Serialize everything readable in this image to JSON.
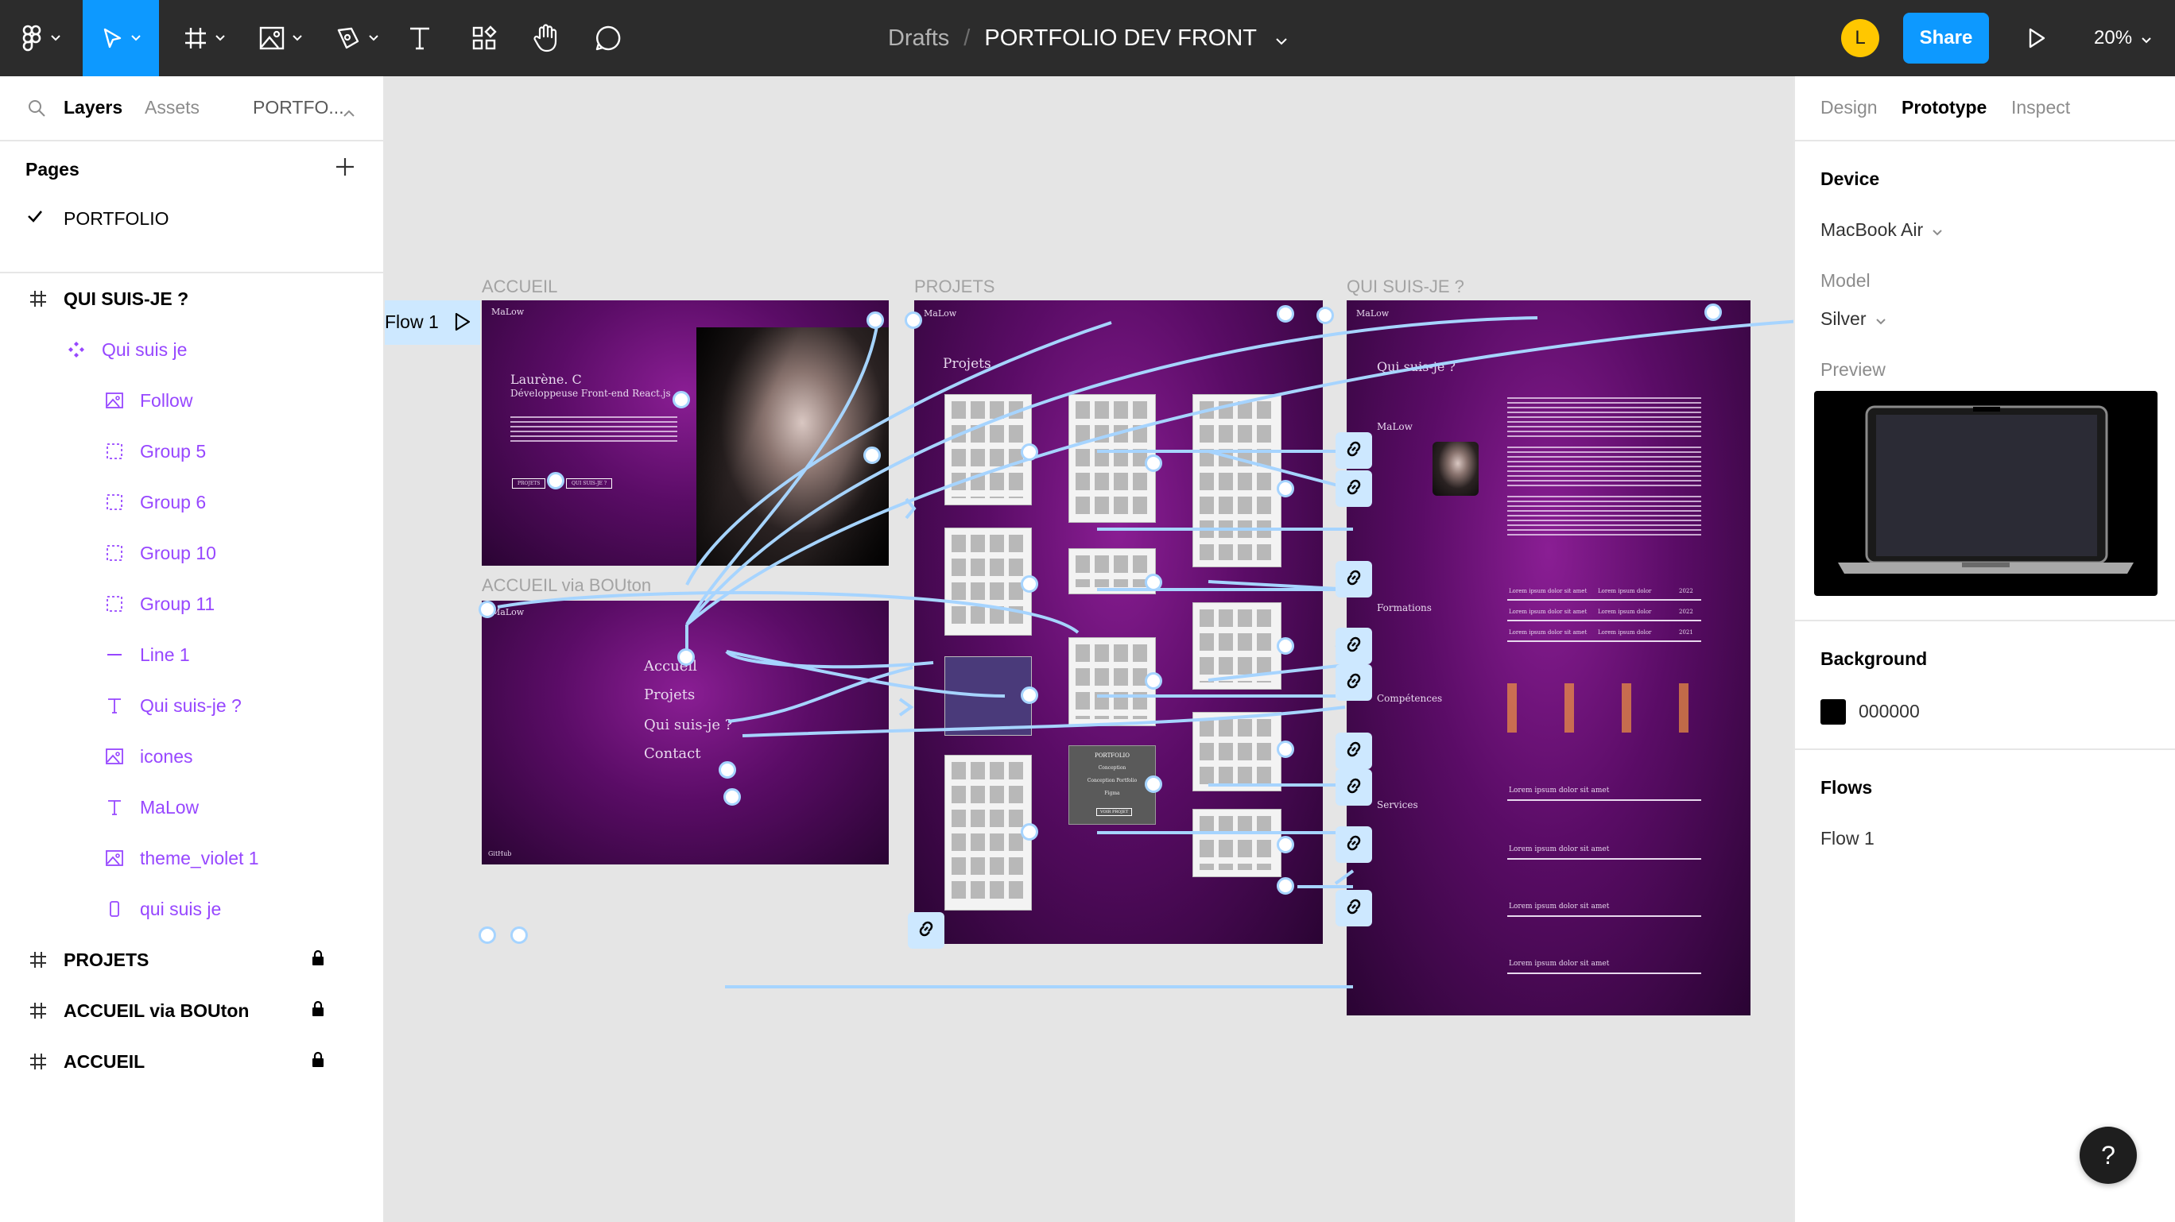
{
  "toolbar": {
    "tools": [
      {
        "name": "main-menu",
        "icon": "figma-logo-icon"
      },
      {
        "name": "move",
        "icon": "move-cursor-icon",
        "active": true
      },
      {
        "name": "frame",
        "icon": "frame-icon"
      },
      {
        "name": "shape",
        "icon": "image-icon"
      },
      {
        "name": "pen",
        "icon": "pen-icon"
      },
      {
        "name": "text",
        "icon": "text-icon"
      },
      {
        "name": "resources",
        "icon": "resources-icon"
      },
      {
        "name": "hand",
        "icon": "hand-icon"
      },
      {
        "name": "comment",
        "icon": "comment-icon"
      }
    ],
    "breadcrumb_root": "Drafts",
    "breadcrumb_sep": "/",
    "file_name": "PORTFOLIO DEV FRONT",
    "avatar_initial": "L",
    "share_label": "Share",
    "zoom_label": "20%",
    "accent_color": "#0d99ff"
  },
  "left_panel": {
    "tabs": {
      "layers": "Layers",
      "assets": "Assets",
      "page": "PORTFO..."
    },
    "pages_title": "Pages",
    "pages": [
      {
        "name": "PORTFOLIO",
        "selected": true
      }
    ],
    "layers": [
      {
        "name": "QUI SUIS-JE ?",
        "kind": "frame",
        "icon": "frame-hash-icon",
        "locked": false
      },
      {
        "name": "Qui suis je",
        "kind": "child1",
        "icon": "component-instance-icon"
      },
      {
        "name": "Follow",
        "kind": "child2",
        "icon": "image-layer-icon"
      },
      {
        "name": "Group 5",
        "kind": "child2",
        "icon": "group-icon"
      },
      {
        "name": "Group 6",
        "kind": "child2",
        "icon": "group-icon"
      },
      {
        "name": "Group 10",
        "kind": "child2",
        "icon": "group-icon"
      },
      {
        "name": "Group 11",
        "kind": "child2",
        "icon": "group-icon"
      },
      {
        "name": "Line 1",
        "kind": "child2",
        "icon": "line-icon"
      },
      {
        "name": "Qui suis-je ?",
        "kind": "child2",
        "icon": "text-layer-icon"
      },
      {
        "name": "icones",
        "kind": "child2",
        "icon": "image-layer-icon"
      },
      {
        "name": "MaLow",
        "kind": "child2",
        "icon": "text-layer-icon"
      },
      {
        "name": "theme_violet 1",
        "kind": "child2",
        "icon": "image-layer-icon"
      },
      {
        "name": "qui suis je",
        "kind": "child2",
        "icon": "rectangle-icon"
      },
      {
        "name": "PROJETS",
        "kind": "frame",
        "icon": "frame-hash-icon",
        "locked": true
      },
      {
        "name": "ACCUEIL via BOUton",
        "kind": "frame",
        "icon": "frame-hash-icon",
        "locked": true
      },
      {
        "name": "ACCUEIL",
        "kind": "frame",
        "icon": "frame-hash-icon",
        "locked": true
      }
    ]
  },
  "canvas": {
    "flow_tag": "Flow 1",
    "frames": {
      "accueil": {
        "label": "ACCUEIL",
        "brand": "MaLow",
        "name": "Laurène. C",
        "role": "Développeuse Front-end React.js",
        "btn1": "PROJETS",
        "btn2": "QUI SUIS-JE ?"
      },
      "accueil_bouton": {
        "label": "ACCUEIL via BOUton",
        "brand": "MaLow",
        "menu": [
          "Accueil",
          "Projets",
          "Qui suis-je ?",
          "Contact"
        ],
        "footer": "GitHub"
      },
      "projets": {
        "label": "PROJETS",
        "brand": "MaLow",
        "heading": "Projets",
        "card_title": "PORTFOLIO",
        "card_lines": [
          "Conception",
          "Conception Portfolio",
          "Figma"
        ],
        "card_btn": "VOIR PROJET"
      },
      "qui_suis_je": {
        "label": "QUI SUIS-JE ?",
        "brand": "MaLow",
        "heading": "Qui suis-je ?",
        "name": "MaLow",
        "sections": [
          "Formations",
          "Compétences",
          "Services"
        ],
        "years": [
          "2022",
          "2022",
          "2021"
        ],
        "formation_label": "Lorem ipsum dolor sit amet",
        "formation_place": "Lorem ipsum dolor",
        "service_title": "Lorem ipsum dolor sit amet"
      }
    }
  },
  "right_panel": {
    "tabs": {
      "design": "Design",
      "prototype": "Prototype",
      "inspect": "Inspect"
    },
    "device_title": "Device",
    "device_value": "MacBook Air",
    "model_label": "Model",
    "model_value": "Silver",
    "preview_label": "Preview",
    "background_title": "Background",
    "background_hex": "000000",
    "background_color": "#000000",
    "flows_title": "Flows",
    "flows": [
      "Flow 1"
    ]
  },
  "help_label": "?"
}
